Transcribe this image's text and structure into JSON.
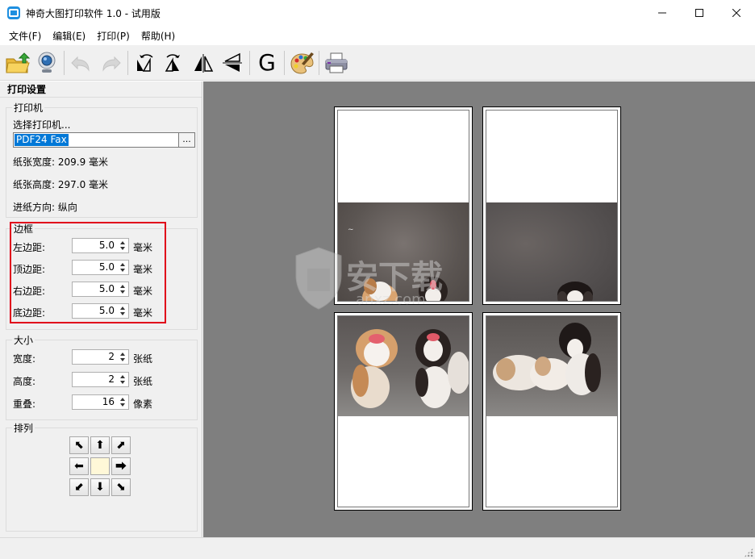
{
  "window": {
    "title": "神奇大图打印软件 1.0 - 试用版"
  },
  "menu": [
    "文件(F)",
    "编辑(E)",
    "打印(P)",
    "帮助(H)"
  ],
  "toolbar": {
    "letter_g": "G"
  },
  "panel": {
    "title": "打印设置",
    "printer": {
      "legend": "打印机",
      "choose_label": "选择打印机...",
      "selected": "PDF24 Fax",
      "browse": "...",
      "width_line": "纸张宽度: 209.9 毫米",
      "height_line": "纸张高度: 297.0 毫米",
      "feed_line": "进纸方向: 纵向"
    },
    "margins": {
      "legend": "边框",
      "rows": [
        {
          "label": "左边距:",
          "value": "5.0",
          "unit": "毫米"
        },
        {
          "label": "顶边距:",
          "value": "5.0",
          "unit": "毫米"
        },
        {
          "label": "右边距:",
          "value": "5.0",
          "unit": "毫米"
        },
        {
          "label": "底边距:",
          "value": "5.0",
          "unit": "毫米"
        }
      ]
    },
    "size": {
      "legend": "大小",
      "rows": [
        {
          "label": "宽度:",
          "value": "2",
          "unit": "张纸"
        },
        {
          "label": "高度:",
          "value": "2",
          "unit": "张纸"
        },
        {
          "label": "重叠:",
          "value": "16",
          "unit": "像素"
        }
      ]
    },
    "arrange": {
      "legend": "排列"
    }
  },
  "colors": {
    "highlight": "#e0001a",
    "canvas_bg": "#7f7f7f",
    "selection": "#0078d7"
  },
  "watermark": {
    "text": "安下载",
    "sub": "anxz.com"
  }
}
